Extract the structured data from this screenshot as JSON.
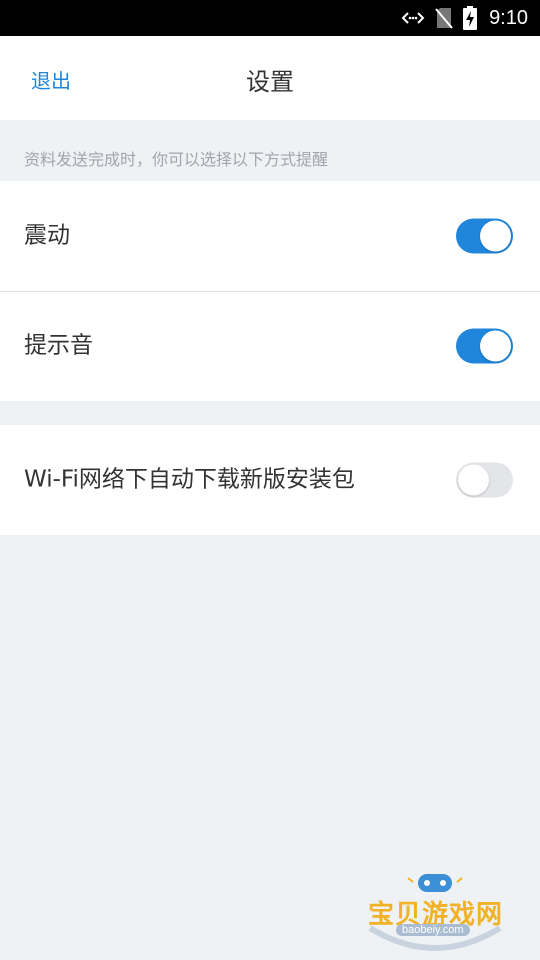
{
  "status_bar": {
    "time": "9:10",
    "icons": [
      "data-transfer-icon",
      "no-sim-icon",
      "battery-charging-icon"
    ]
  },
  "header": {
    "back_label": "退出",
    "title": "设置"
  },
  "hint_text": "资料发送完成时，你可以选择以下方式提醒",
  "settings": [
    {
      "label": "震动",
      "enabled": true
    },
    {
      "label": "提示音",
      "enabled": true
    },
    {
      "label": "Wi-Fi网络下自动下载新版安装包",
      "enabled": false
    }
  ],
  "watermark": {
    "text": "宝贝游戏网",
    "url": "baobeiy.com"
  },
  "colors": {
    "accent": "#1f86dc",
    "background": "#eff2f5",
    "toggle_off": "#e3e5e9",
    "hint": "#a1a6ac",
    "watermark": "#f1b227"
  }
}
